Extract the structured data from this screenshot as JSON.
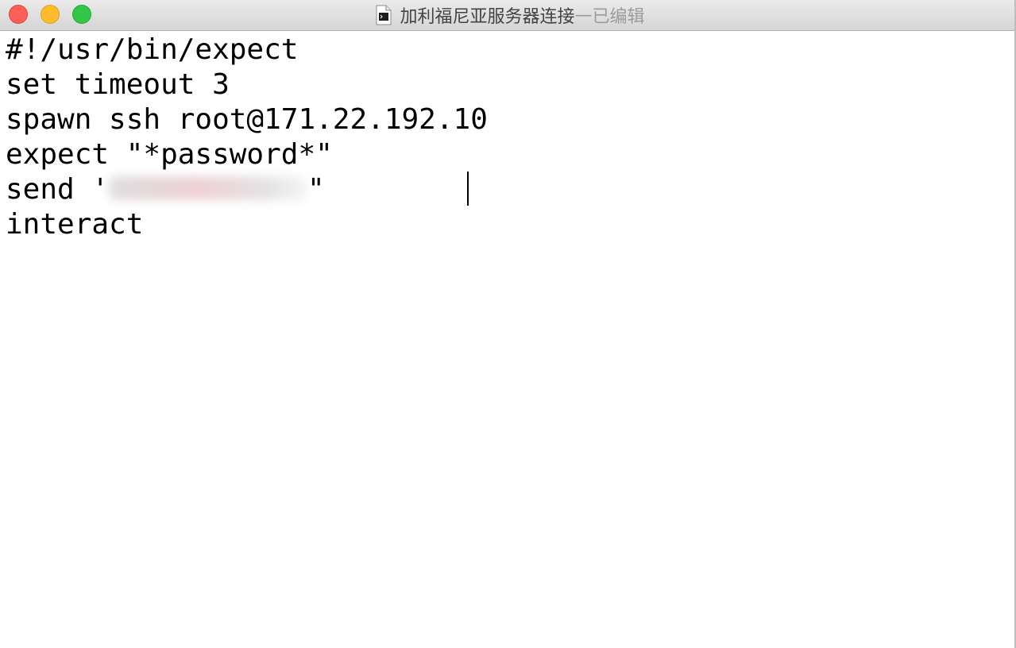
{
  "window": {
    "title": "加利福尼亚服务器连接",
    "separator": " — ",
    "status": "已编辑"
  },
  "editor": {
    "lines": [
      "#!/usr/bin/expect",
      "set timeout 3",
      "spawn ssh root@171.22.192.10",
      "expect \"*password*\"",
      "send '",
      "interact"
    ],
    "line5_suffix": "\""
  },
  "icons": {
    "document": "terminal-document-icon"
  }
}
